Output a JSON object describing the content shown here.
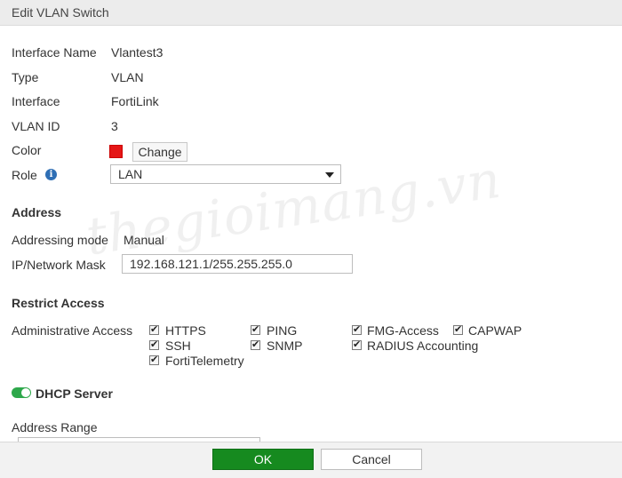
{
  "window": {
    "title": "Edit VLAN Switch"
  },
  "fields": {
    "interface_name": {
      "label": "Interface Name",
      "value": "Vlantest3"
    },
    "type": {
      "label": "Type",
      "value": "VLAN"
    },
    "interface": {
      "label": "Interface",
      "value": "FortiLink"
    },
    "vlan_id": {
      "label": "VLAN ID",
      "value": "3"
    },
    "color": {
      "label": "Color",
      "swatch": "#e51616",
      "change_label": "Change"
    },
    "role": {
      "label": "Role",
      "value": "LAN",
      "info_icon": "info-icon"
    }
  },
  "address": {
    "title": "Address",
    "mode_label": "Addressing mode",
    "mode_value": "Manual",
    "ip_label": "IP/Network Mask",
    "ip_value": "192.168.121.1/255.255.255.0"
  },
  "restrict_access": {
    "title": "Restrict Access",
    "admin_label": "Administrative Access",
    "options": [
      {
        "label": "HTTPS",
        "checked": true
      },
      {
        "label": "PING",
        "checked": true
      },
      {
        "label": "FMG-Access",
        "checked": true
      },
      {
        "label": "CAPWAP",
        "checked": true
      },
      {
        "label": "SSH",
        "checked": true
      },
      {
        "label": "SNMP",
        "checked": true
      },
      {
        "label": "RADIUS Accounting",
        "checked": true
      },
      {
        "label": "FortiTelemetry",
        "checked": true
      }
    ]
  },
  "dhcp": {
    "label": "DHCP Server",
    "enabled": true,
    "toggle_color": "#2ea84b",
    "address_range_label": "Address Range"
  },
  "footer": {
    "ok_label": "OK",
    "cancel_label": "Cancel",
    "ok_color": "#168a1f"
  },
  "watermark": "thegioimang.vn"
}
